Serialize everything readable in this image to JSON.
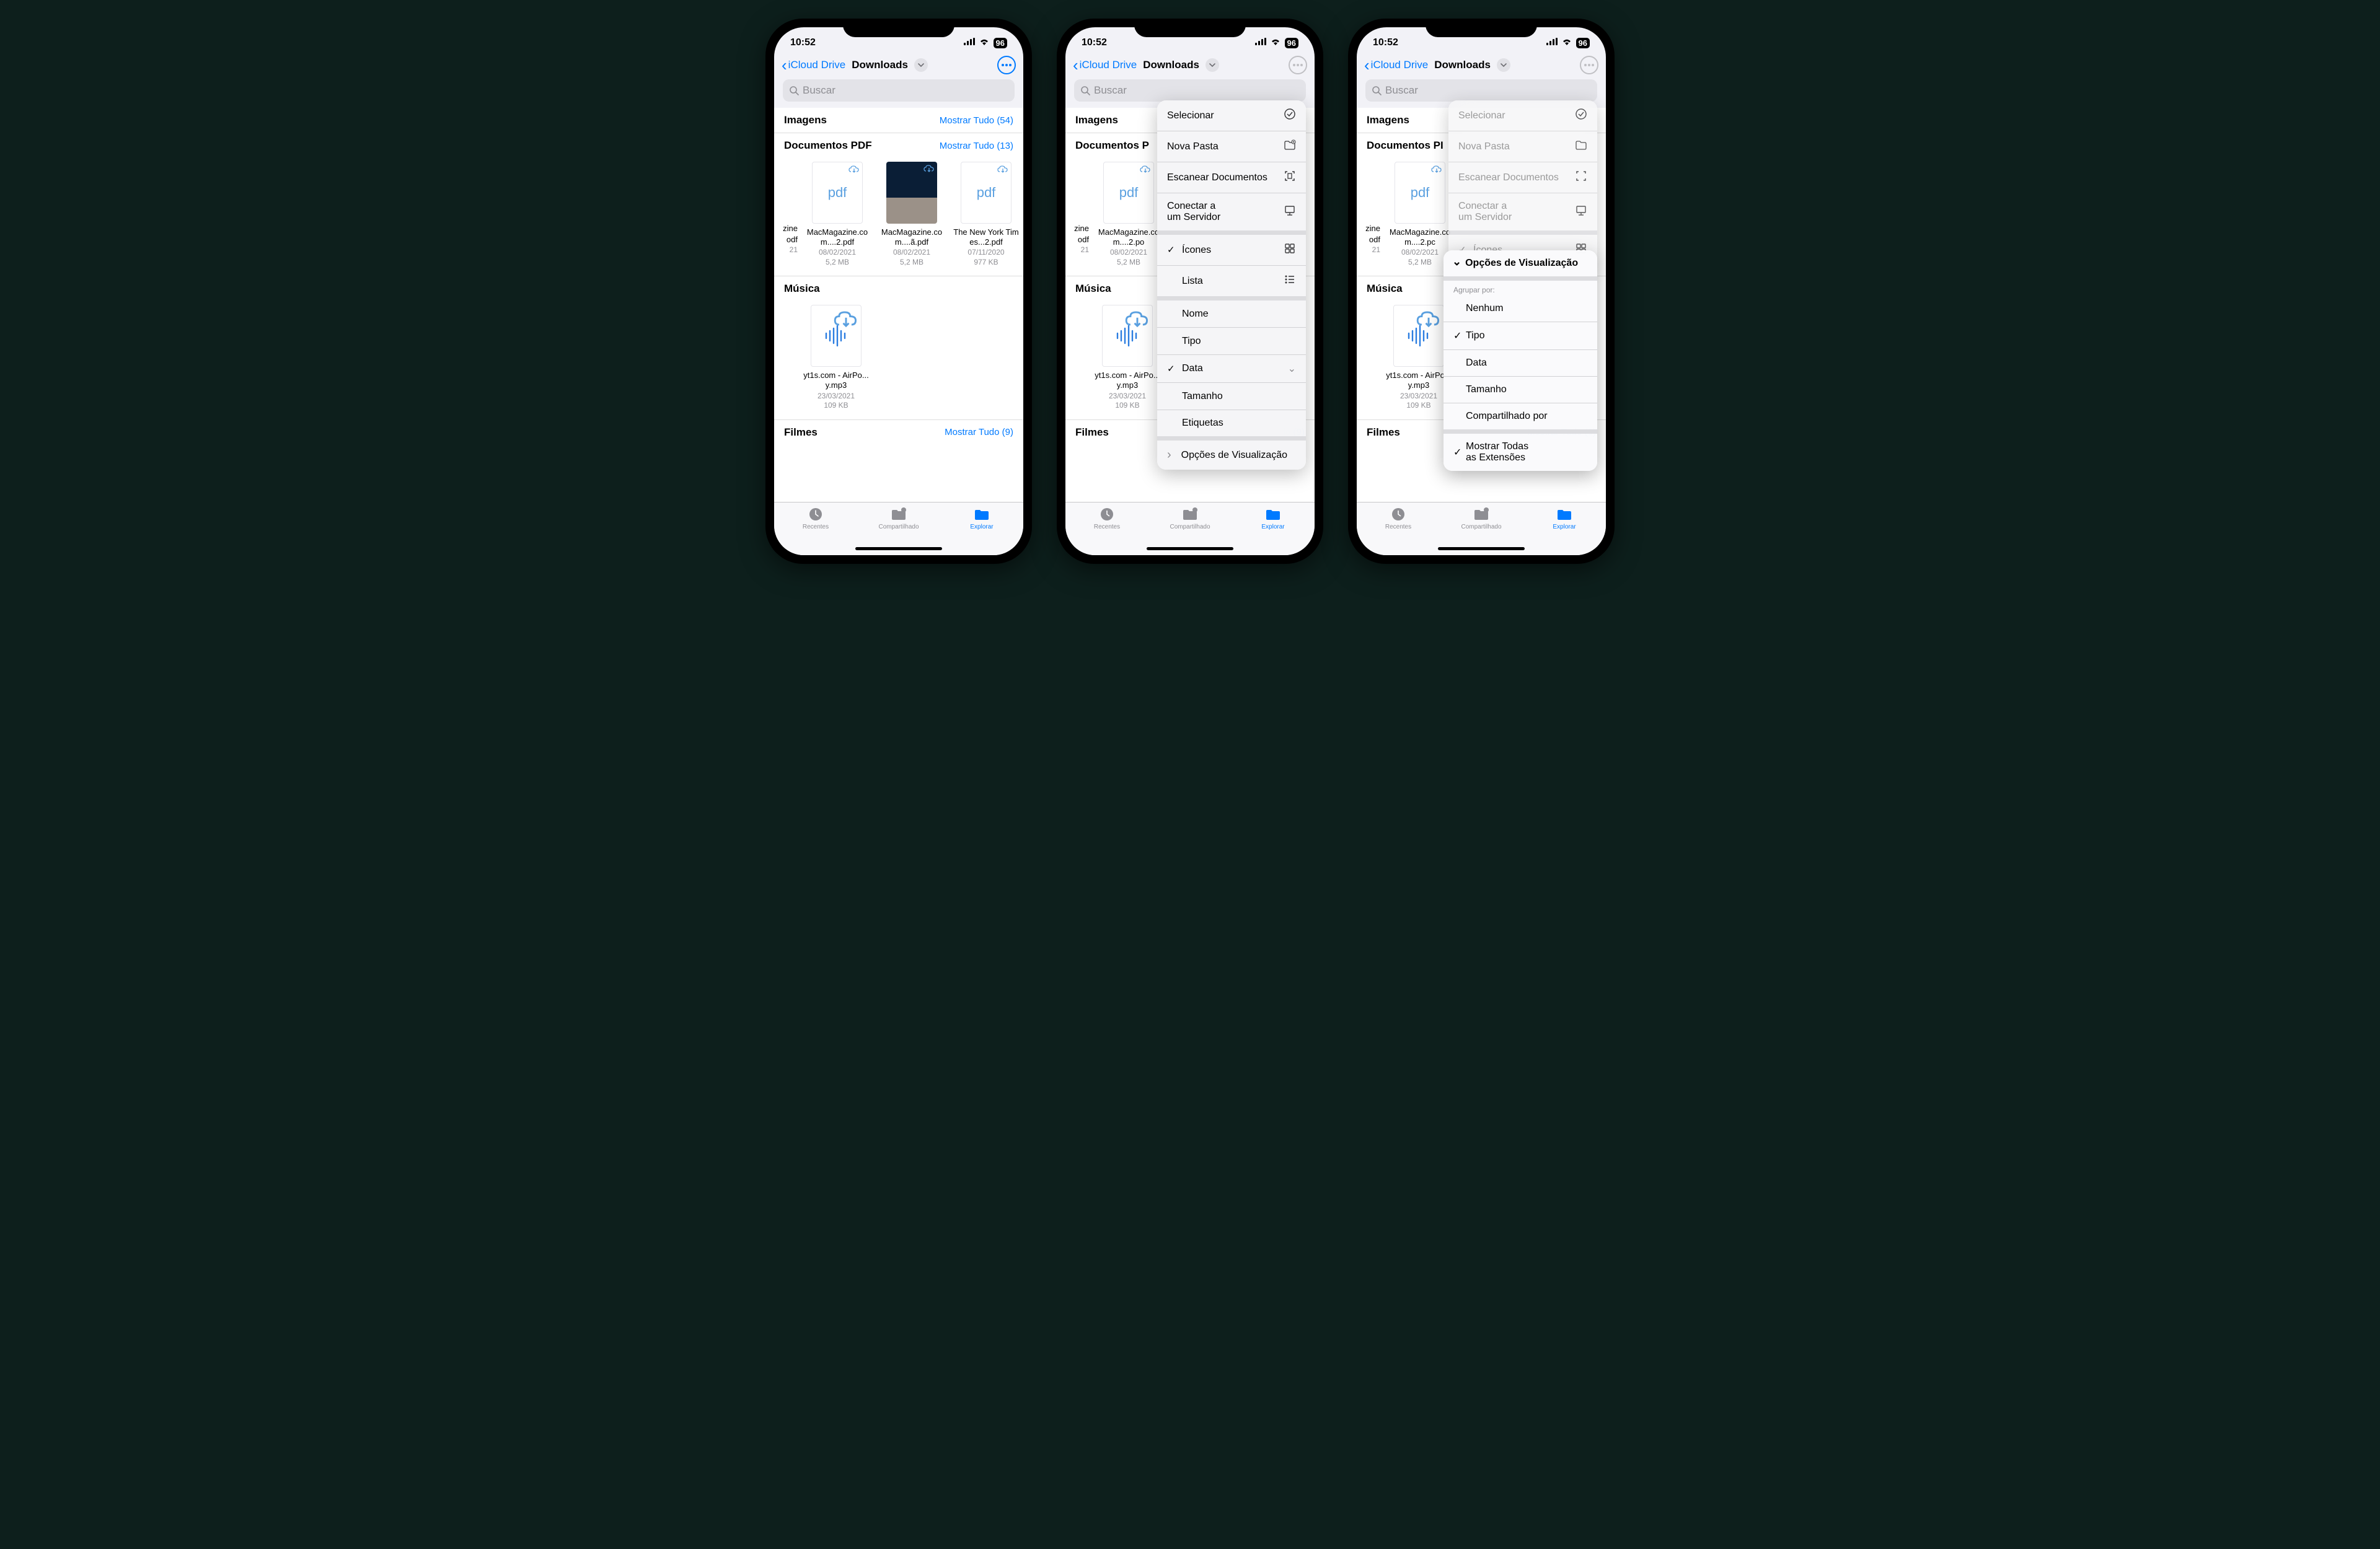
{
  "status": {
    "time": "10:52",
    "battery": "96"
  },
  "nav": {
    "back": "iCloud Drive",
    "title": "Downloads"
  },
  "search": {
    "placeholder": "Buscar"
  },
  "sections": {
    "imagens": {
      "title": "Imagens",
      "show_all": "Mostrar Tudo (54)"
    },
    "pdf": {
      "title": "Documentos PDF",
      "show_all": "Mostrar Tudo (13)"
    },
    "musica": {
      "title": "Música"
    },
    "filmes": {
      "title": "Filmes",
      "show_all": "Mostrar Tudo (9)"
    }
  },
  "files": {
    "cut1": {
      "name": "zine",
      "ext": "odf",
      "date": "21"
    },
    "pdf1": {
      "name": "MacMagazine.com....2.pdf",
      "date": "08/02/2021",
      "size": "5,2 MB"
    },
    "pdf2": {
      "name": "MacMagazine.com....ã.pdf",
      "date": "08/02/2021",
      "size": "5,2 MB"
    },
    "pdf3": {
      "name": "The New York Times...2.pdf",
      "date": "07/11/2020",
      "size": "977 KB"
    },
    "audio1": {
      "name": "yt1s.com - AirPo...y.mp3",
      "date": "23/03/2021",
      "size": "109 KB"
    },
    "pdf1b": {
      "name": "MacMagazine.com....2.po",
      "date": "08/02/2021",
      "size": "5,2 MB"
    },
    "pdf1c": {
      "name": "MacMagazine.com....2.pc",
      "date": "08/02/2021",
      "size": "5,2 MB"
    },
    "audio1b": {
      "name": "yt1s.com - AirPo...y.mp3",
      "date": "23/03/2021",
      "size": "109 KB"
    }
  },
  "tabs": {
    "recents": "Recentes",
    "shared": "Compartilhado",
    "browse": "Explorar"
  },
  "menu": {
    "select": "Selecionar",
    "new_folder": "Nova Pasta",
    "scan": "Escanear Documentos",
    "connect": "Conectar a\num Servidor",
    "icons": "Ícones",
    "list": "Lista",
    "name": "Nome",
    "type": "Tipo",
    "date": "Data",
    "size": "Tamanho",
    "tags": "Etiquetas",
    "view_options": "Opções de Visualização"
  },
  "submenu": {
    "title": "Opções de Visualização",
    "group_by": "Agrupar por:",
    "none": "Nenhum",
    "type": "Tipo",
    "date": "Data",
    "size": "Tamanho",
    "shared_by": "Compartilhado por",
    "show_ext": "Mostrar Todas\nas Extensões"
  }
}
